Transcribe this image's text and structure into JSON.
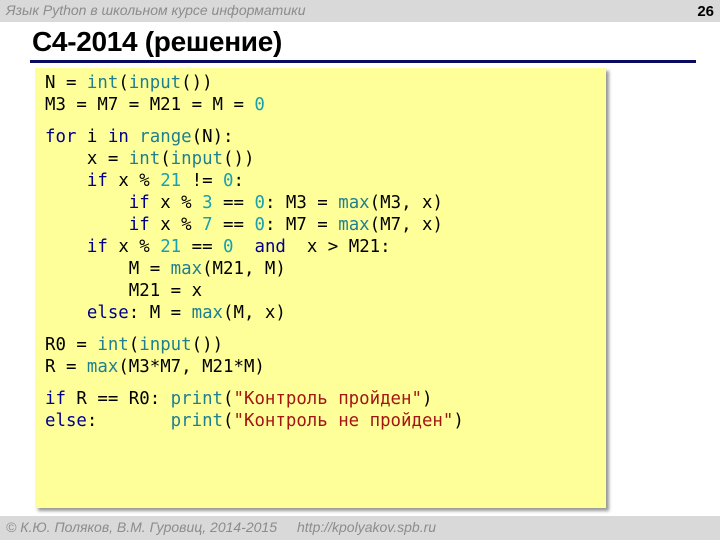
{
  "header": {
    "course_title": "Язык Python в школьном курсе информатики",
    "page_number": "26"
  },
  "slide": {
    "title": "C4-2014 (решение)"
  },
  "code": {
    "lines": [
      [
        {
          "t": "N = ",
          "c": ""
        },
        {
          "t": "int",
          "c": "fn"
        },
        {
          "t": "(",
          "c": ""
        },
        {
          "t": "input",
          "c": "fn"
        },
        {
          "t": "())",
          "c": ""
        }
      ],
      [
        {
          "t": "M3 = M7 = M21 = M = ",
          "c": ""
        },
        {
          "t": "0",
          "c": "num"
        }
      ],
      "gap",
      [
        {
          "t": "for",
          "c": "kw"
        },
        {
          "t": " i ",
          "c": ""
        },
        {
          "t": "in",
          "c": "kw"
        },
        {
          "t": " ",
          "c": ""
        },
        {
          "t": "range",
          "c": "fn"
        },
        {
          "t": "(N):",
          "c": ""
        }
      ],
      [
        {
          "t": "    x = ",
          "c": ""
        },
        {
          "t": "int",
          "c": "fn"
        },
        {
          "t": "(",
          "c": ""
        },
        {
          "t": "input",
          "c": "fn"
        },
        {
          "t": "())",
          "c": ""
        }
      ],
      [
        {
          "t": "    ",
          "c": ""
        },
        {
          "t": "if",
          "c": "kw"
        },
        {
          "t": " x % ",
          "c": ""
        },
        {
          "t": "21",
          "c": "num"
        },
        {
          "t": " != ",
          "c": ""
        },
        {
          "t": "0",
          "c": "num"
        },
        {
          "t": ":",
          "c": ""
        }
      ],
      [
        {
          "t": "        ",
          "c": ""
        },
        {
          "t": "if",
          "c": "kw"
        },
        {
          "t": " x % ",
          "c": ""
        },
        {
          "t": "3",
          "c": "num"
        },
        {
          "t": " == ",
          "c": ""
        },
        {
          "t": "0",
          "c": "num"
        },
        {
          "t": ": M3 = ",
          "c": ""
        },
        {
          "t": "max",
          "c": "fn"
        },
        {
          "t": "(M3, x)",
          "c": ""
        }
      ],
      [
        {
          "t": "        ",
          "c": ""
        },
        {
          "t": "if",
          "c": "kw"
        },
        {
          "t": " x % ",
          "c": ""
        },
        {
          "t": "7",
          "c": "num"
        },
        {
          "t": " == ",
          "c": ""
        },
        {
          "t": "0",
          "c": "num"
        },
        {
          "t": ": M7 = ",
          "c": ""
        },
        {
          "t": "max",
          "c": "fn"
        },
        {
          "t": "(M7, x)",
          "c": ""
        }
      ],
      [
        {
          "t": "    ",
          "c": ""
        },
        {
          "t": "if",
          "c": "kw"
        },
        {
          "t": " x % ",
          "c": ""
        },
        {
          "t": "21",
          "c": "num"
        },
        {
          "t": " == ",
          "c": ""
        },
        {
          "t": "0",
          "c": "num"
        },
        {
          "t": "  ",
          "c": ""
        },
        {
          "t": "and",
          "c": "kw"
        },
        {
          "t": "  x > M21:",
          "c": ""
        }
      ],
      [
        {
          "t": "        M = ",
          "c": ""
        },
        {
          "t": "max",
          "c": "fn"
        },
        {
          "t": "(M21, M)",
          "c": ""
        }
      ],
      [
        {
          "t": "        M21 = x",
          "c": ""
        }
      ],
      [
        {
          "t": "    ",
          "c": ""
        },
        {
          "t": "else",
          "c": "kw"
        },
        {
          "t": ": M = ",
          "c": ""
        },
        {
          "t": "max",
          "c": "fn"
        },
        {
          "t": "(M, x)",
          "c": ""
        }
      ],
      "gap",
      [
        {
          "t": "R0 = ",
          "c": ""
        },
        {
          "t": "int",
          "c": "fn"
        },
        {
          "t": "(",
          "c": ""
        },
        {
          "t": "input",
          "c": "fn"
        },
        {
          "t": "())",
          "c": ""
        }
      ],
      [
        {
          "t": "R = ",
          "c": ""
        },
        {
          "t": "max",
          "c": "fn"
        },
        {
          "t": "(M3*M7, M21*M)",
          "c": ""
        }
      ],
      "gap",
      [
        {
          "t": "if",
          "c": "kw"
        },
        {
          "t": " R == R0: ",
          "c": ""
        },
        {
          "t": "print",
          "c": "fn"
        },
        {
          "t": "(",
          "c": ""
        },
        {
          "t": "\"Контроль пройден\"",
          "c": "str"
        },
        {
          "t": ")",
          "c": ""
        }
      ],
      [
        {
          "t": "else",
          "c": "kw"
        },
        {
          "t": ":       ",
          "c": ""
        },
        {
          "t": "print",
          "c": "fn"
        },
        {
          "t": "(",
          "c": ""
        },
        {
          "t": "\"Контроль не пройден\"",
          "c": "str"
        },
        {
          "t": ")",
          "c": ""
        }
      ]
    ]
  },
  "footer": {
    "copyright": "© К.Ю. Поляков, В.М. Гуровиц, 2014-2015",
    "url": "http://kpolyakov.spb.ru"
  },
  "colors": {
    "code_background": "#ffff99",
    "title_rule": "#0a0a5e",
    "keyword": "#00008b",
    "builtin": "#1f7f8f",
    "number": "#19a0b0",
    "string": "#a31515"
  }
}
